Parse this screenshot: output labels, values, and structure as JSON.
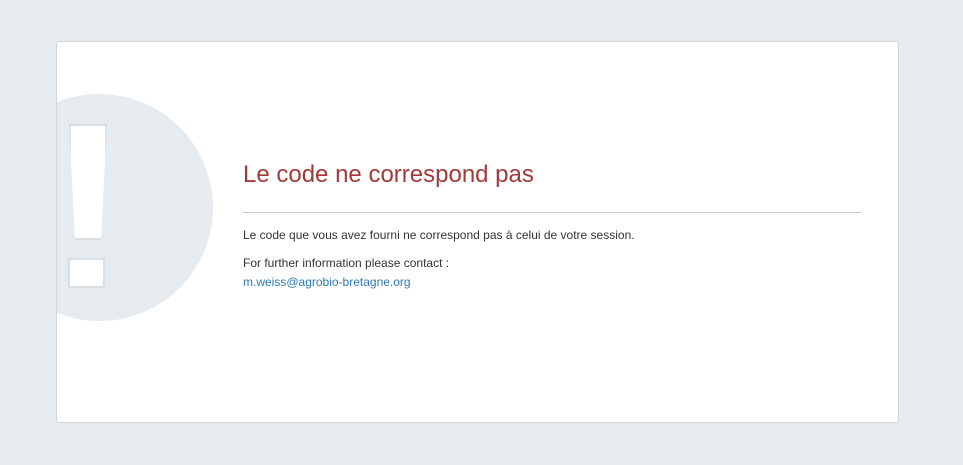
{
  "error": {
    "title": "Le code ne correspond pas",
    "message": "Le code que vous avez fourni ne correspond pas à celui de votre session.",
    "contact_label": "For further information please contact :",
    "contact_email": "m.weiss@agrobio-bretagne.org",
    "icon": "exclamation-icon"
  },
  "colors": {
    "page_background": "#e6ebef",
    "card_background": "#ffffff",
    "title": "#a33a3a",
    "link": "#2a7ab5",
    "text": "#333333"
  }
}
